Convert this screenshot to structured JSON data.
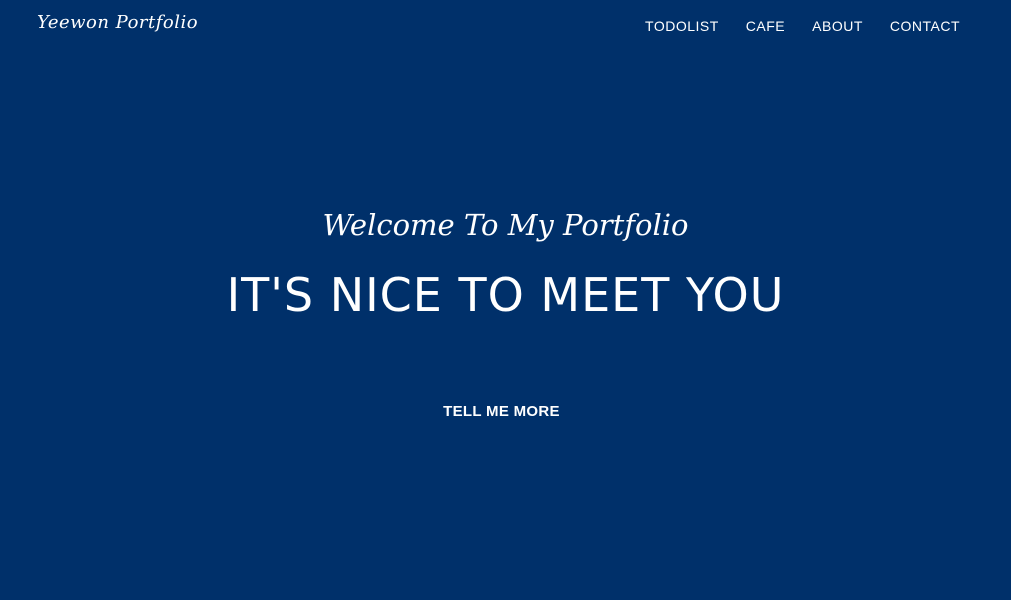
{
  "navbar": {
    "brand": "Yeewon Portfolio",
    "links": [
      {
        "label": "TODOLIST"
      },
      {
        "label": "CAFE"
      },
      {
        "label": "ABOUT"
      },
      {
        "label": "CONTACT"
      }
    ]
  },
  "hero": {
    "lead": "Welcome To My Portfolio",
    "heading": "IT'S NICE TO MEET YOU",
    "button_label": "TELL ME MORE"
  },
  "colors": {
    "background": "#00306a",
    "text": "#ffffff"
  }
}
